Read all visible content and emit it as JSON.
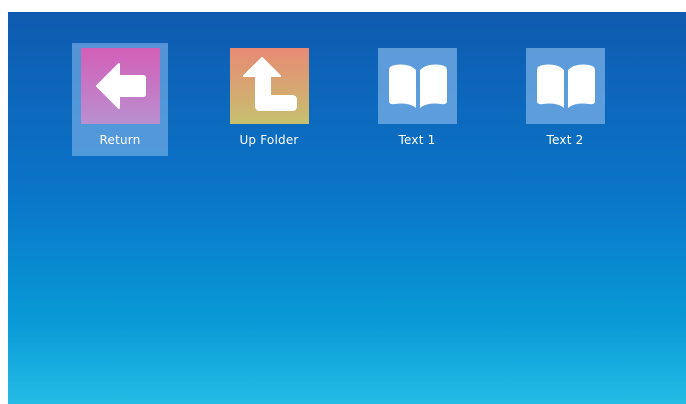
{
  "items": [
    {
      "label": "Return",
      "icon": "arrow-left-icon",
      "selected": true
    },
    {
      "label": "Up Folder",
      "icon": "arrow-up-return-icon",
      "selected": false
    },
    {
      "label": "Text 1",
      "icon": "book-icon",
      "selected": false
    },
    {
      "label": "Text 2",
      "icon": "book-icon",
      "selected": false
    }
  ],
  "colors": {
    "background_top": "#0f5bb0",
    "background_bottom": "#12b6e2",
    "return_tile_top": "#d35fb7",
    "return_tile_bottom": "#b98fd0",
    "upfolder_tile_top": "#e88a74",
    "upfolder_tile_bottom": "#c7c06f",
    "book_tile": "#78afe6",
    "selection_highlight": "#8cbef0",
    "label_text": "#ffffff"
  }
}
